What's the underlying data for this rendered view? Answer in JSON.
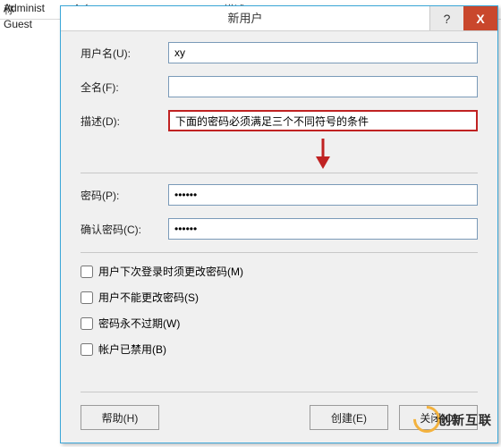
{
  "background": {
    "col1_header": "称",
    "col2_header": "全名",
    "col3_header": "描述",
    "items": [
      "Administ",
      "Guest"
    ]
  },
  "dialog": {
    "title": "新用户",
    "help_glyph": "?",
    "close_glyph": "X",
    "labels": {
      "username": "用户名(U):",
      "fullname": "全名(F):",
      "description": "描述(D):",
      "password": "密码(P):",
      "confirm_password": "确认密码(C):"
    },
    "values": {
      "username": "xy",
      "fullname": "",
      "description": "下面的密码必须满足三个不同符号的条件",
      "password": "••••••",
      "confirm_password": "••••••"
    },
    "checkboxes": {
      "must_change": "用户下次登录时须更改密码(M)",
      "cannot_change": "用户不能更改密码(S)",
      "never_expires": "密码永不过期(W)",
      "disabled": "帐户已禁用(B)"
    },
    "buttons": {
      "help": "帮助(H)",
      "create": "创建(E)",
      "close": "关闭(O)"
    },
    "annotation_arrow_color": "#c02222"
  },
  "watermark": {
    "text": "创新互联"
  }
}
